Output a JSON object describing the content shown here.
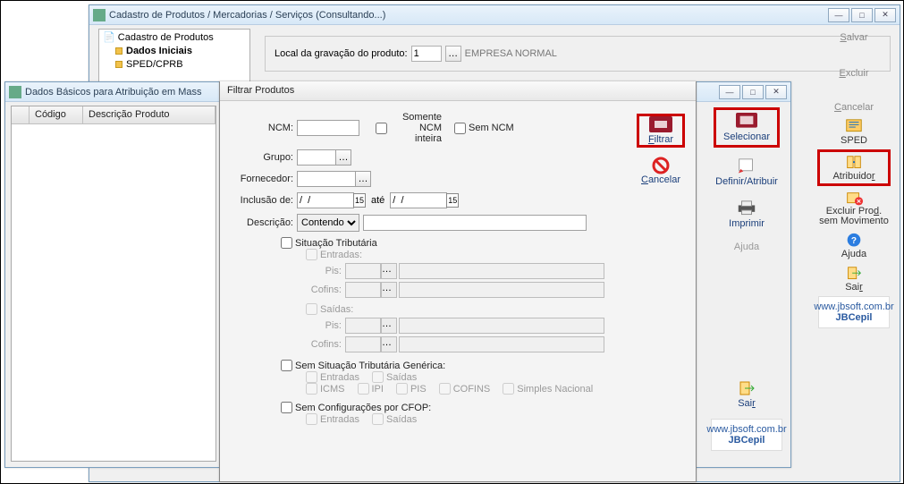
{
  "main_window": {
    "title": "Cadastro de Produtos / Mercadorias / Serviços (Consultando...)",
    "tree": {
      "root": "Cadastro de Produtos",
      "n1": "Dados Iniciais",
      "n2": "SPED/CPRB"
    },
    "local_label": "Local da gravação do produto:",
    "local_value": "1",
    "local_desc": "EMPRESA NORMAL",
    "right": {
      "salvar": "Salvar",
      "excluir": "Excluir",
      "cancelar": "Cancelar",
      "sped": "SPED",
      "atribuidor": "Atribuidor",
      "excluir_prod": "Excluir Prod. sem Movimento",
      "ajuda": "Ajuda",
      "sair": "Sair",
      "logo1": "www.jbsoft.com.br",
      "logo1b": "JBCepil"
    }
  },
  "mass_window": {
    "title": "Dados Básicos para Atribuição em Mass",
    "col1": "Código",
    "col2": "Descrição Produto",
    "tools": {
      "selecionar": "Selecionar",
      "definir": "Definir/Atribuir",
      "imprimir": "Imprimir",
      "ajuda": "Ajuda",
      "sair": "Sair",
      "logo": "www.jbsoft.com.br",
      "logob": "JBCepil"
    }
  },
  "dialog": {
    "title": "Filtrar Produtos",
    "ncm": "NCM:",
    "som_ncm": "Somente NCM inteira",
    "sem_ncm": "Sem NCM",
    "grupo": "Grupo:",
    "fornecedor": "Fornecedor:",
    "inclusao": "Inclusão de:",
    "ate": "até",
    "date_ph": "/  /",
    "descricao": "Descrição:",
    "contendo": "Contendo",
    "sit_trib": "Situação Tributária",
    "entradas": "Entradas:",
    "saidas": "Saídas:",
    "pis": "Pis:",
    "cofins": "Cofins:",
    "sem_sit": "Sem Situação Tributária Genérica:",
    "sem_cfop": "Sem Configurações por CFOP:",
    "c_entradas": "Entradas",
    "c_saidas": "Saídas",
    "c_icms": "ICMS",
    "c_ipi": "IPI",
    "c_pis": "PIS",
    "c_cofins": "COFINS",
    "c_simples": "Simples Nacional",
    "filtrar": "Filtrar",
    "cancelar": "Cancelar"
  }
}
